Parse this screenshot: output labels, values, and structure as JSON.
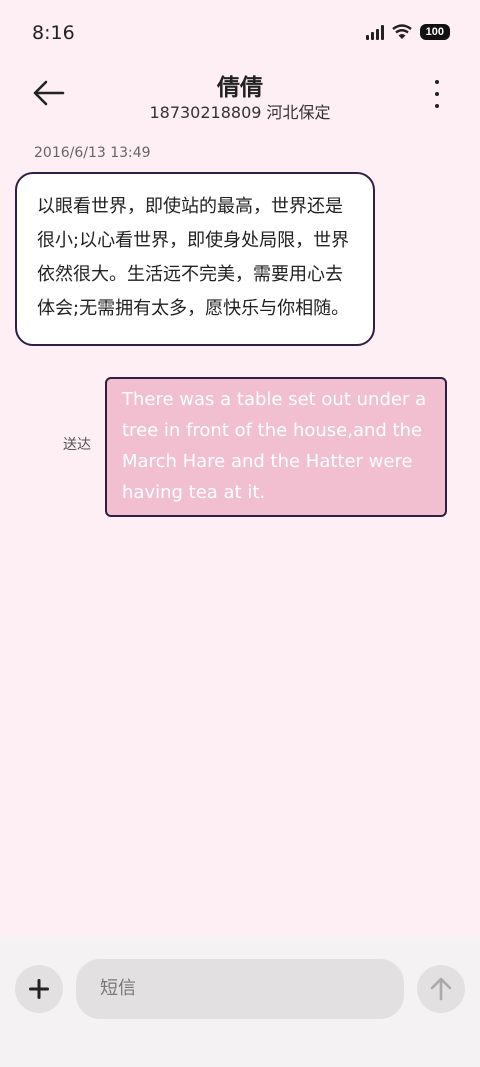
{
  "status_bar": {
    "time": "8:16",
    "battery": "100"
  },
  "header": {
    "contact_name": "倩倩",
    "contact_info": "18730218809 河北保定"
  },
  "messages": [
    {
      "direction": "incoming",
      "timestamp": "2016/6/13 13:49",
      "text": "以眼看世界，即使站的最高，世界还是很小;以心看世界，即使身处局限，世界依然很大。生活远不完美，需要用心去体会;无需拥有太多，愿快乐与你相随。"
    },
    {
      "direction": "outgoing",
      "status": "送达",
      "text": "There was a table set out under a tree in front of the house,and the March Hare and the Hatter were having tea at it."
    }
  ],
  "composer": {
    "placeholder": "短信"
  },
  "colors": {
    "background": "#fdeff3",
    "incoming_bubble": "#ffffff",
    "outgoing_bubble": "#f1bfd0",
    "bubble_border": "#2e1f45"
  }
}
